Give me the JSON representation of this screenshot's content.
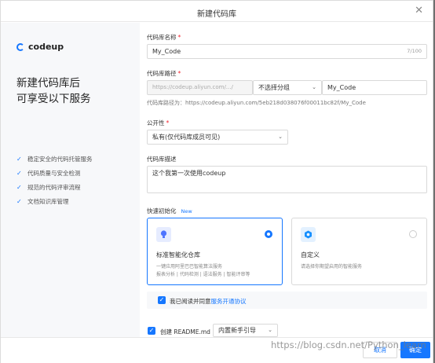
{
  "dialog": {
    "title": "新建代码库",
    "close_icon": "close-icon"
  },
  "sidebar": {
    "logo_text": "codeup",
    "headline_line1": "新建代码库后",
    "headline_line2": "可享受以下服务",
    "features": [
      "稳定安全的代码托管服务",
      "代码质量与安全检测",
      "规范的代码评审流程",
      "文档知识库管理"
    ]
  },
  "form": {
    "name_label": "代码库名称",
    "name_value": "My_Code",
    "name_counter": "7/100",
    "path_label": "代码库路径",
    "path_prefix": "https://codeup.aliyun.com/.../",
    "group_select": "不选择分组",
    "path_value": "My_Code",
    "path_hint": "代码库路径为：https://codeup.aliyun.com/5eb218d038076f00011bc82f/My_Code",
    "visibility_label": "公开性",
    "visibility_value": "私有(仅代码库成员可见)",
    "desc_label": "代码库描述",
    "desc_value": "这个我第一次使用codeup",
    "quick_init_label": "快速初始化",
    "quick_init_badge": "New",
    "cards": [
      {
        "title": "标准智能化仓库",
        "desc1": "一键应用阿里巴巴智能算法服务",
        "desc2": "报表分析 | 代码检测 | 语法服务 | 智能评审等",
        "selected": true
      },
      {
        "title": "自定义",
        "desc1": "请选择你期望启用的智能服务",
        "desc2": "",
        "selected": false
      }
    ],
    "agree_text": "我已阅读并同意",
    "agree_link": "服务开通协议",
    "readme_label": "创建 README.md",
    "readme_select": "内置新手引导"
  },
  "footer": {
    "cancel_label": "取消",
    "ok_label": "确定"
  },
  "watermark": "https://blog.csdn.net/Python_learn"
}
